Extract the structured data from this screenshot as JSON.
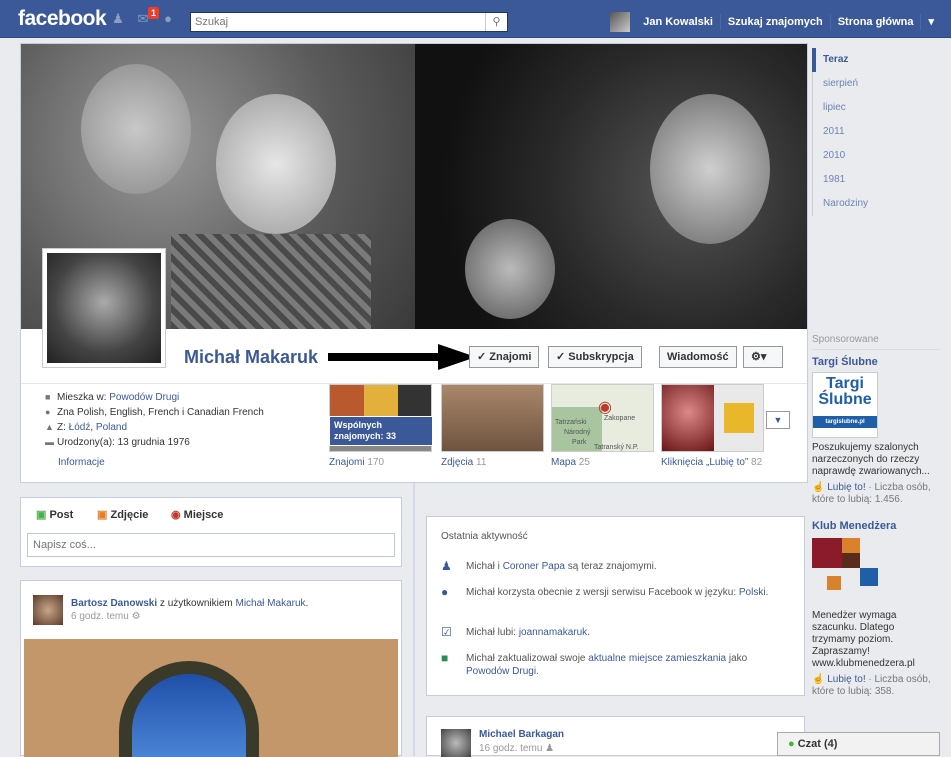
{
  "topbar": {
    "logo": "facebook",
    "notif_count": "1",
    "search_placeholder": "Szukaj",
    "user_name": "Jan Kowalski",
    "find_friends": "Szukaj znajomych",
    "home": "Strona główna"
  },
  "timeline_nav": [
    "Teraz",
    "sierpień",
    "lipiec",
    "2011",
    "2010",
    "1981",
    "Narodziny"
  ],
  "profile": {
    "name": "Michał Makaruk",
    "friends_button": "✓ Znajomi",
    "subscribe_button": "✓ Subskrypcja",
    "message_button": "Wiadomość",
    "info": {
      "lives_prefix": "Mieszka w: ",
      "lives_link": "Powodów Drugi",
      "languages": "Zna Polish, English, French i Canadian French",
      "from_prefix": "Z: ",
      "from_city": "Łódź",
      "from_country": "Poland",
      "born": "Urodzony(a): 13 grudnia 1976",
      "info_link": "Informacje"
    },
    "mutual_tooltip": "Wspólnych znajomych: 33",
    "apps": [
      {
        "label": "Znajomi",
        "count": "170"
      },
      {
        "label": "Zdjęcia",
        "count": "11"
      },
      {
        "label": "Mapa",
        "count": "25"
      },
      {
        "label": "Kliknięcia „Lubię to”",
        "count": "82"
      }
    ],
    "map_labels": [
      "Zakopane",
      "Tatrzański",
      "Národný",
      "Park",
      "Tatranský N.P."
    ]
  },
  "composer": {
    "tab_post": "Post",
    "tab_photo": "Zdjęcie",
    "tab_place": "Miejsce",
    "placeholder": "Napisz coś..."
  },
  "post1": {
    "author": "Bartosz Danowski",
    "with_text": " z użytkownikiem ",
    "with_user": "Michał Makaruk",
    "time": "6 godz. temu"
  },
  "activity": {
    "title": "Ostatnia aktywność",
    "items": [
      {
        "pre": "Michał i ",
        "link": "Coroner Papa",
        "post": " są teraz znajomymi."
      },
      {
        "pre": "Michał korzysta obecnie z wersji serwisu Facebook w języku: ",
        "link": "Polski",
        "post": "."
      },
      {
        "pre": "Michał lubi: ",
        "link": "joannamakaruk",
        "post": "."
      },
      {
        "pre": "Michał zaktualizował swoje ",
        "link": "aktualne miejsce zamieszkania",
        "post": " jako ",
        "link2": "Powodów Drugi",
        "post2": "."
      }
    ]
  },
  "post2": {
    "author": "Michael Barkagan",
    "time": "16 godz. temu"
  },
  "ads": {
    "label": "Sponsorowane",
    "ad1": {
      "title": "Targi Ślubne",
      "logo_line1": "Targi",
      "logo_line2": "Ślubne",
      "logo_url": "targislubne.pl",
      "text": "Poszukujemy szalonych narzeczonych do rzeczy naprawdę zwariowanych...",
      "like": "Lubię to!",
      "likes": " · Liczba osób, które to lubią: 1.456."
    },
    "ad2": {
      "title": "Klub Menedżera",
      "text": "Menedżer wymaga szacunku. Dlatego trzymamy poziom. Zapraszamy! www.klubmenedzera.pl",
      "like": "Lubię to!",
      "likes": " · Liczba osób, które to lubią: 358."
    }
  },
  "chat": "Czat (4)",
  "colors": {
    "brand": "#3b5998",
    "background": "#e9ebee"
  }
}
